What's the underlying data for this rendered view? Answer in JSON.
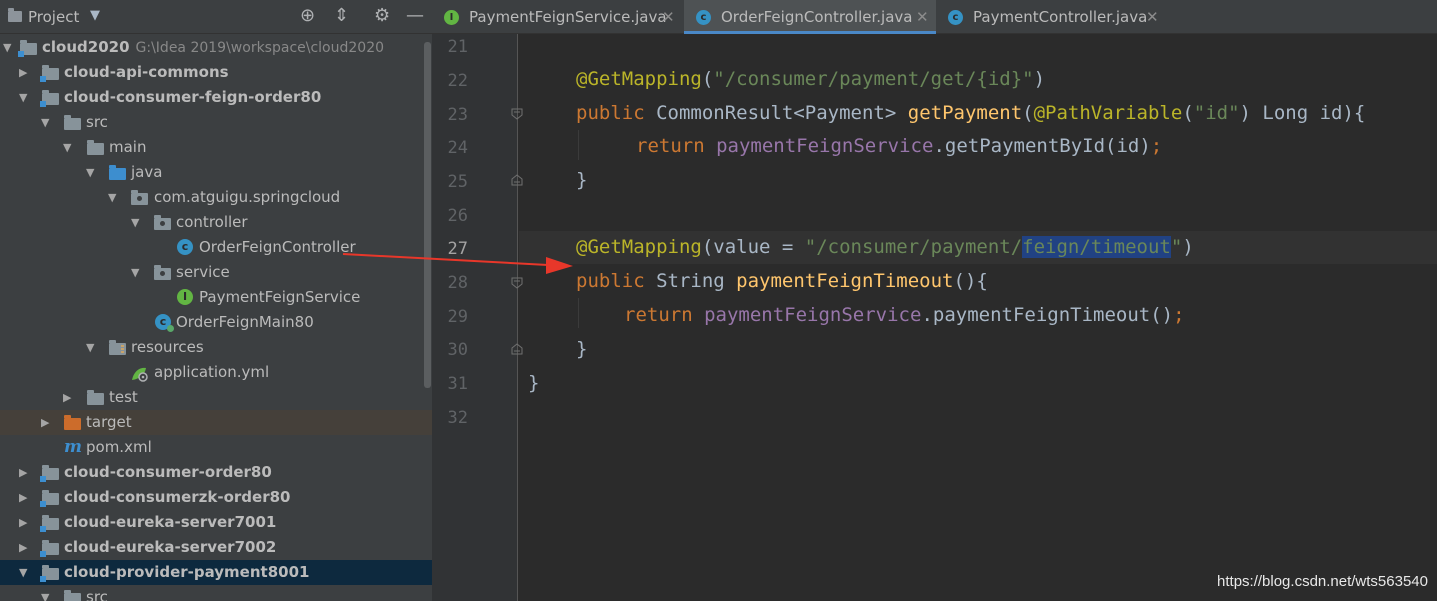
{
  "project_panel": {
    "title": "Project",
    "icons": [
      "globe-icon",
      "collapse-icon",
      "gear-icon",
      "minimize-icon"
    ],
    "tree": [
      {
        "label": "cloud2020",
        "path": "G:\\Idea 2019\\workspace\\cloud2020",
        "bold": true,
        "expanded": true,
        "icon": "module-folder-icon"
      },
      {
        "label": "cloud-api-commons",
        "bold": true,
        "expanded": false,
        "icon": "module-folder-icon"
      },
      {
        "label": "cloud-consumer-feign-order80",
        "bold": true,
        "expanded": true,
        "icon": "module-folder-icon"
      },
      {
        "label": "src",
        "expanded": true,
        "icon": "folder-icon"
      },
      {
        "label": "main",
        "expanded": true,
        "icon": "folder-icon"
      },
      {
        "label": "java",
        "expanded": true,
        "icon": "source-folder-icon"
      },
      {
        "label": "com.atguigu.springcloud",
        "expanded": true,
        "icon": "package-icon"
      },
      {
        "label": "controller",
        "expanded": true,
        "icon": "package-icon"
      },
      {
        "label": "OrderFeignController",
        "icon": "class-icon"
      },
      {
        "label": "service",
        "expanded": true,
        "icon": "package-icon"
      },
      {
        "label": "PaymentFeignService",
        "icon": "interface-icon"
      },
      {
        "label": "OrderFeignMain80",
        "icon": "main-class-icon"
      },
      {
        "label": "resources",
        "expanded": true,
        "icon": "resources-folder-icon"
      },
      {
        "label": "application.yml",
        "icon": "yml-icon"
      },
      {
        "label": "test",
        "expanded": false,
        "icon": "folder-icon"
      },
      {
        "label": "target",
        "expanded": false,
        "icon": "excluded-folder-icon"
      },
      {
        "label": "pom.xml",
        "icon": "maven-icon"
      },
      {
        "label": "cloud-consumer-order80",
        "bold": true,
        "expanded": false,
        "icon": "module-folder-icon"
      },
      {
        "label": "cloud-consumerzk-order80",
        "bold": true,
        "expanded": false,
        "icon": "module-folder-icon"
      },
      {
        "label": "cloud-eureka-server7001",
        "bold": true,
        "expanded": false,
        "icon": "module-folder-icon"
      },
      {
        "label": "cloud-eureka-server7002",
        "bold": true,
        "expanded": false,
        "icon": "module-folder-icon"
      },
      {
        "label": "cloud-provider-payment8001",
        "bold": true,
        "expanded": true,
        "icon": "module-folder-icon",
        "selected": true
      },
      {
        "label": "src",
        "expanded": true,
        "icon": "folder-icon"
      }
    ]
  },
  "editor": {
    "tabs": [
      {
        "label": "PaymentFeignService.java",
        "icon": "interface-icon",
        "active": false
      },
      {
        "label": "OrderFeignController.java",
        "icon": "class-icon",
        "active": true
      },
      {
        "label": "PaymentController.java",
        "icon": "class-icon",
        "active": false
      }
    ],
    "line_numbers": [
      "21",
      "22",
      "23",
      "24",
      "25",
      "26",
      "27",
      "28",
      "29",
      "30",
      "31",
      "32"
    ],
    "current_line": "27",
    "code": {
      "l22": {
        "anno": "@GetMapping",
        "p1": "(",
        "str": "\"/consumer/payment/get/{id}\"",
        "p2": ")"
      },
      "l23": {
        "kw": "public",
        "t1": " CommonResult<Payment> ",
        "fn": "getPayment",
        "p1": "(",
        "anno": "@PathVariable",
        "p2": "(",
        "str": "\"id\"",
        "p3": ") Long id){"
      },
      "l24": {
        "kw": "return",
        "sp": " ",
        "fld": "paymentFeignService",
        "t1": ".getPaymentById(id)",
        "semi": ";"
      },
      "l25": {
        "t1": "}"
      },
      "l27": {
        "anno": "@GetMapping",
        "t1": "(value = ",
        "str1": "\"/consumer/payment/",
        "sel": "feign/timeout",
        "str2": "\"",
        "p2": ")"
      },
      "l28": {
        "kw": "public",
        "t1": " String ",
        "fn": "paymentFeignTimeout",
        "t2": "(){"
      },
      "l29": {
        "kw": "return",
        "sp": " ",
        "fld": "paymentFeignService",
        "t1": ".paymentFeignTimeout()",
        "semi": ";"
      },
      "l30": {
        "t1": "}"
      },
      "l31": {
        "t1": "}"
      }
    }
  },
  "watermark": "https://blog.csdn.net/wts563540",
  "colors": {
    "annotation": "#bbb529",
    "string": "#6a8759",
    "keyword": "#cc7832",
    "method": "#ffc66d",
    "field": "#9876aa",
    "arrow": "#e8372a",
    "selection": "#214283"
  }
}
